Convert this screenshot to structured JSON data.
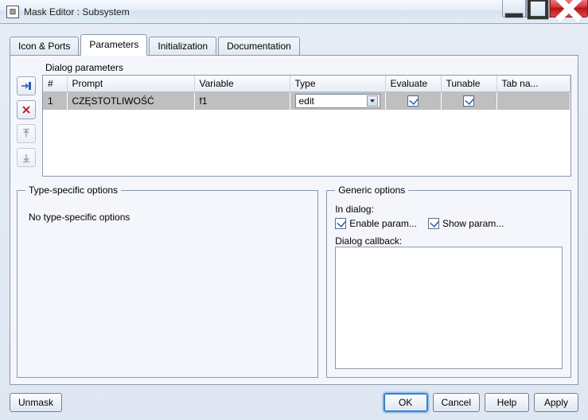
{
  "window": {
    "title": "Mask Editor : Subsystem",
    "app_icon_glyph": "▨"
  },
  "tabs": [
    {
      "label": "Icon & Ports",
      "active": false
    },
    {
      "label": "Parameters",
      "active": true
    },
    {
      "label": "Initialization",
      "active": false
    },
    {
      "label": "Documentation",
      "active": false
    }
  ],
  "sidebar_icons": {
    "add": "add-row-icon",
    "delete": "delete-row-icon",
    "up": "move-up-icon",
    "down": "move-down-icon"
  },
  "params_section": {
    "label": "Dialog parameters",
    "columns": {
      "num": "#",
      "prompt": "Prompt",
      "variable": "Variable",
      "type": "Type",
      "evaluate": "Evaluate",
      "tunable": "Tunable",
      "tabname": "Tab na..."
    },
    "rows": [
      {
        "num": "1",
        "prompt": "CZĘSTOTLIWOŚĆ",
        "variable": "f1",
        "type": "edit",
        "evaluate": true,
        "tunable": true,
        "tabname": ""
      }
    ]
  },
  "type_options": {
    "legend": "Type-specific options",
    "message": "No type-specific options"
  },
  "generic_options": {
    "legend": "Generic options",
    "in_dialog_label": "In dialog:",
    "enable_param_label": "Enable param...",
    "enable_param_checked": true,
    "show_param_label": "Show param...",
    "show_param_checked": true,
    "callback_label": "Dialog callback:",
    "callback_value": ""
  },
  "buttons": {
    "unmask": "Unmask",
    "ok": "OK",
    "cancel": "Cancel",
    "help": "Help",
    "apply": "Apply"
  }
}
